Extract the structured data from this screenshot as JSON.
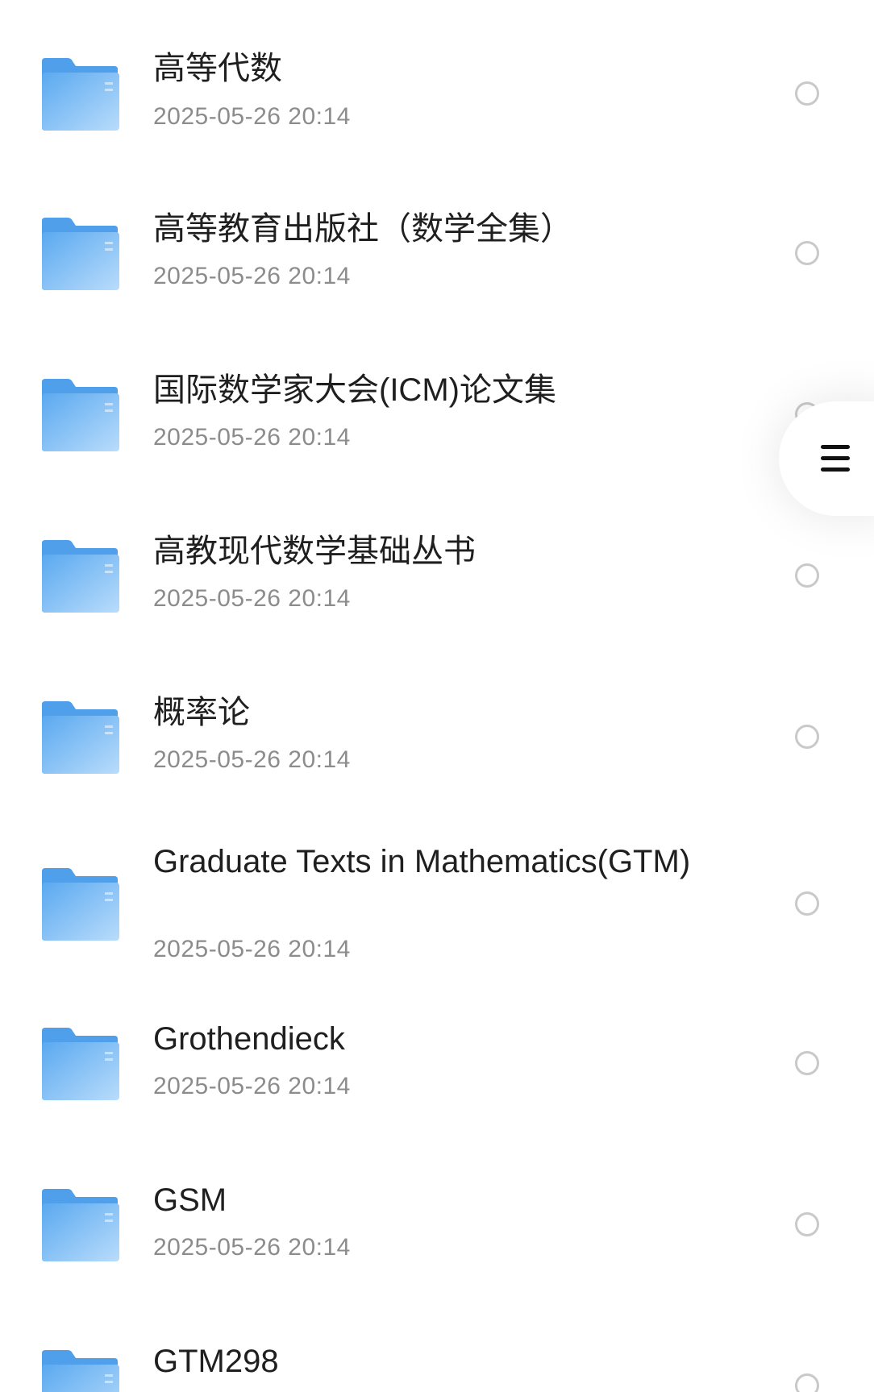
{
  "files": [
    {
      "name": "高等代数",
      "date": "2025-05-26 20:14",
      "icon": "folder-icon"
    },
    {
      "name": "高等教育出版社（数学全集）",
      "date": "2025-05-26 20:14",
      "icon": "folder-icon"
    },
    {
      "name": "国际数学家大会(ICM)论文集",
      "date": "2025-05-26 20:14",
      "icon": "folder-icon"
    },
    {
      "name": "高教现代数学基础丛书",
      "date": "2025-05-26 20:14",
      "icon": "folder-icon"
    },
    {
      "name": "概率论",
      "date": "2025-05-26 20:14",
      "icon": "folder-icon"
    },
    {
      "name": "Graduate Texts in Mathematics(GTM)",
      "date": "2025-05-26 20:14",
      "icon": "folder-icon"
    },
    {
      "name": "Grothendieck",
      "date": "2025-05-26 20:14",
      "icon": "folder-icon"
    },
    {
      "name": "GSM",
      "date": "2025-05-26 20:14",
      "icon": "folder-icon"
    },
    {
      "name": "GTM298",
      "date": "",
      "icon": "folder-icon"
    }
  ],
  "floating_menu": {
    "icon": "menu-icon"
  },
  "colors": {
    "folder_light": "#b9dcfb",
    "folder_dark": "#5aa9f0",
    "text_primary": "#1f1f1f",
    "text_secondary": "#8c8c8c",
    "radio_border": "#c9c9c9"
  }
}
